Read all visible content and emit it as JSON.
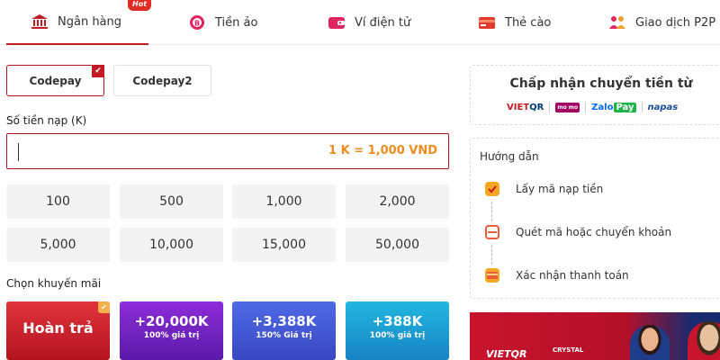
{
  "tabs": [
    {
      "label": "Ngân hàng",
      "icon": "bank-icon",
      "active": true
    },
    {
      "label": "Tiền ảo",
      "icon": "bitcoin-icon",
      "active": false
    },
    {
      "label": "Ví điện tử",
      "icon": "wallet-icon",
      "active": false
    },
    {
      "label": "Thẻ cào",
      "icon": "card-icon",
      "active": false
    },
    {
      "label": "Giao dịch P2P",
      "icon": "people-icon",
      "active": false
    }
  ],
  "hot_badge": "Hot",
  "methods": [
    {
      "label": "Codepay",
      "selected": true
    },
    {
      "label": "Codepay2",
      "selected": false
    }
  ],
  "amount": {
    "label": "Số tiền nạp (K)",
    "value": "",
    "rate": "1 K = 1,000 VND"
  },
  "quick_amounts": [
    "100",
    "500",
    "1,000",
    "2,000",
    "5,000",
    "10,000",
    "15,000",
    "50,000"
  ],
  "promo_label": "Chọn khuyến mãi",
  "promos": [
    {
      "big": "Hoàn trả",
      "small": "",
      "style": "hoantra",
      "selected": true
    },
    {
      "big": "+20,000K",
      "small": "100% giá trị",
      "style": "purple",
      "selected": false
    },
    {
      "big": "+3,388K",
      "small": "150% Giá trị",
      "style": "blue",
      "selected": false
    },
    {
      "big": "+388K",
      "small": "100% giá trị",
      "style": "cyan",
      "selected": false
    }
  ],
  "accept": {
    "title": "Chấp nhận chuyển tiền từ",
    "vietqr_a": "VIET",
    "vietqr_b": "QR",
    "momo": "mo mo",
    "zalo": "Zalo",
    "zalo_pay": "Pay",
    "napas": "napas"
  },
  "guide": {
    "title": "Hướng dẫn",
    "steps": [
      {
        "label": "Lấy mã nạp tiền",
        "icon": "code-icon"
      },
      {
        "label": "Quét mã hoặc chuyển khoản",
        "icon": "scan-icon"
      },
      {
        "label": "Xác nhận thanh toán",
        "icon": "confirm-card-icon"
      }
    ]
  },
  "banner": {
    "text": "VIETQR",
    "text2": "CRYSTAL"
  },
  "colors": {
    "accent": "#c21b26",
    "rate": "#f08c1e"
  }
}
